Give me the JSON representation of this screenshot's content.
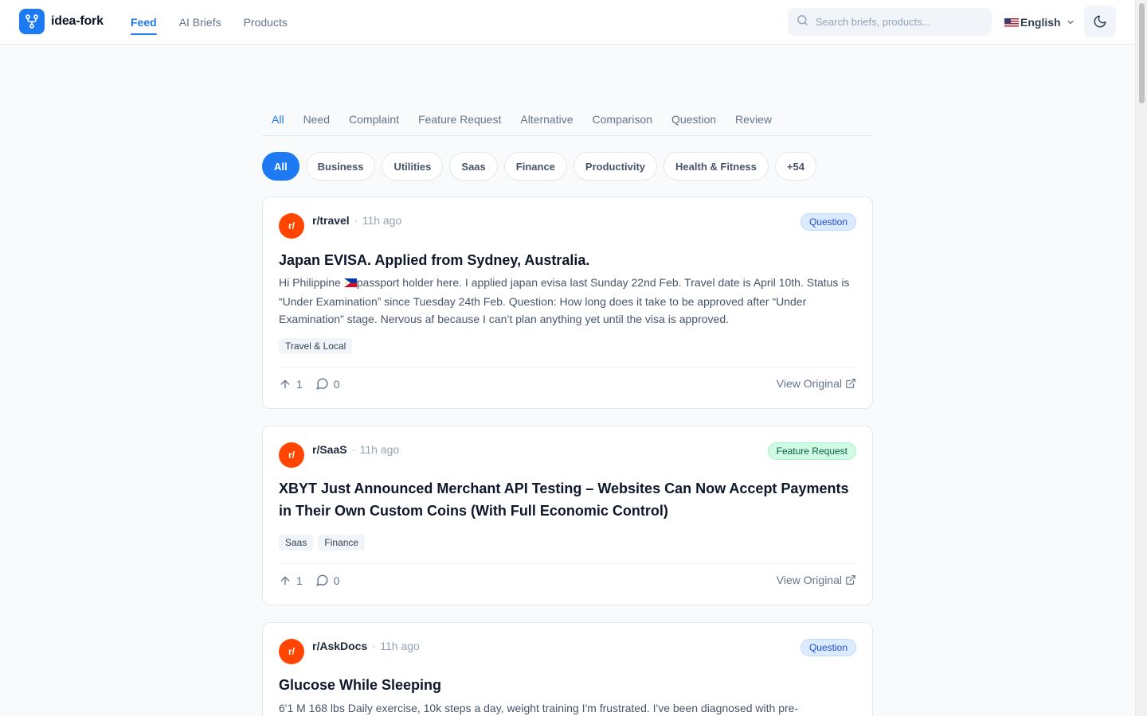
{
  "app": {
    "name": "idea-fork"
  },
  "nav": [
    {
      "label": "Feed",
      "active": true
    },
    {
      "label": "AI Briefs",
      "active": false
    },
    {
      "label": "Products",
      "active": false
    }
  ],
  "search": {
    "placeholder": "Search briefs, products..."
  },
  "language": {
    "label": "English",
    "flag_icon": "us-flag-icon"
  },
  "theme_toggle": {
    "icon": "moon-icon"
  },
  "tabs": [
    "All",
    "Need",
    "Complaint",
    "Feature Request",
    "Alternative",
    "Comparison",
    "Question",
    "Review"
  ],
  "active_tab": "All",
  "chips": [
    "All",
    "Business",
    "Utilities",
    "Saas",
    "Finance",
    "Productivity",
    "Health & Fitness",
    "+54"
  ],
  "active_chip": "All",
  "colors": {
    "accent": "#1d7af3",
    "reddit": "#ff4500"
  },
  "posts": [
    {
      "avatar": "r/",
      "subreddit": "r/travel",
      "time": "11h ago",
      "badge": "Question",
      "title": "Japan EVISA. Applied from Sydney, Australia.",
      "body_before_flag": "Hi Philippine ",
      "body_after_flag": "passport holder here. I applied japan evisa last Sunday 22nd Feb. Travel date is April 10th. Status is “Under Examination” since Tuesday 24th Feb. Question: How long does it take to be approved after “Under Examination” stage. Nervous af because I can’t plan anything yet until the visa is approved.",
      "tags": [
        "Travel & Local"
      ],
      "upvotes": "1",
      "comments": "0",
      "view_label": "View Original"
    },
    {
      "avatar": "r/",
      "subreddit": "r/SaaS",
      "time": "11h ago",
      "badge": "Feature Request",
      "title": "XBYT Just Announced Merchant API Testing – Websites Can Now Accept Payments in Their Own Custom Coins (With Full Economic Control)",
      "tags": [
        "Saas",
        "Finance"
      ],
      "upvotes": "1",
      "comments": "0",
      "view_label": "View Original"
    },
    {
      "avatar": "r/",
      "subreddit": "r/AskDocs",
      "time": "11h ago",
      "badge": "Question",
      "title": "Glucose While Sleeping",
      "body": "6'1 M 168 lbs Daily exercise, 10k steps a day, weight training I'm frustrated. I've been diagnosed with pre-"
    }
  ]
}
